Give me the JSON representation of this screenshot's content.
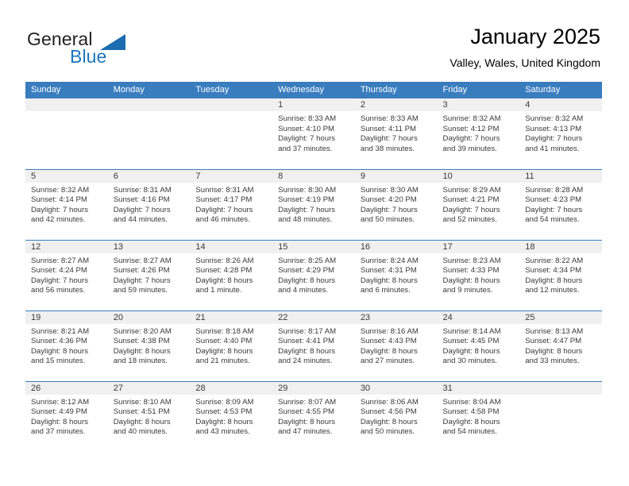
{
  "brand": {
    "name_part1": "General",
    "name_part2": "Blue",
    "triangle_color": "#1b6cb0",
    "text_color": "#231f20",
    "blue_color": "#1b76bc"
  },
  "header": {
    "title": "January 2025",
    "subtitle": "Valley, Wales, United Kingdom"
  },
  "theme": {
    "header_bg": "#3a7dbf",
    "header_text": "#ffffff",
    "daystrip_bg": "#f0f0f0",
    "body_text": "#3a3a3a"
  },
  "weekdays": [
    "Sunday",
    "Monday",
    "Tuesday",
    "Wednesday",
    "Thursday",
    "Friday",
    "Saturday"
  ],
  "labels": {
    "sunrise": "Sunrise:",
    "sunset": "Sunset:",
    "daylight": "Daylight:"
  },
  "weeks": [
    [
      {
        "day": "",
        "empty": true
      },
      {
        "day": "",
        "empty": true
      },
      {
        "day": "",
        "empty": true
      },
      {
        "day": "1",
        "sunrise": "Sunrise: 8:33 AM",
        "sunset": "Sunset: 4:10 PM",
        "daylight1": "Daylight: 7 hours",
        "daylight2": "and 37 minutes."
      },
      {
        "day": "2",
        "sunrise": "Sunrise: 8:33 AM",
        "sunset": "Sunset: 4:11 PM",
        "daylight1": "Daylight: 7 hours",
        "daylight2": "and 38 minutes."
      },
      {
        "day": "3",
        "sunrise": "Sunrise: 8:32 AM",
        "sunset": "Sunset: 4:12 PM",
        "daylight1": "Daylight: 7 hours",
        "daylight2": "and 39 minutes."
      },
      {
        "day": "4",
        "sunrise": "Sunrise: 8:32 AM",
        "sunset": "Sunset: 4:13 PM",
        "daylight1": "Daylight: 7 hours",
        "daylight2": "and 41 minutes."
      }
    ],
    [
      {
        "day": "5",
        "sunrise": "Sunrise: 8:32 AM",
        "sunset": "Sunset: 4:14 PM",
        "daylight1": "Daylight: 7 hours",
        "daylight2": "and 42 minutes."
      },
      {
        "day": "6",
        "sunrise": "Sunrise: 8:31 AM",
        "sunset": "Sunset: 4:16 PM",
        "daylight1": "Daylight: 7 hours",
        "daylight2": "and 44 minutes."
      },
      {
        "day": "7",
        "sunrise": "Sunrise: 8:31 AM",
        "sunset": "Sunset: 4:17 PM",
        "daylight1": "Daylight: 7 hours",
        "daylight2": "and 46 minutes."
      },
      {
        "day": "8",
        "sunrise": "Sunrise: 8:30 AM",
        "sunset": "Sunset: 4:19 PM",
        "daylight1": "Daylight: 7 hours",
        "daylight2": "and 48 minutes."
      },
      {
        "day": "9",
        "sunrise": "Sunrise: 8:30 AM",
        "sunset": "Sunset: 4:20 PM",
        "daylight1": "Daylight: 7 hours",
        "daylight2": "and 50 minutes."
      },
      {
        "day": "10",
        "sunrise": "Sunrise: 8:29 AM",
        "sunset": "Sunset: 4:21 PM",
        "daylight1": "Daylight: 7 hours",
        "daylight2": "and 52 minutes."
      },
      {
        "day": "11",
        "sunrise": "Sunrise: 8:28 AM",
        "sunset": "Sunset: 4:23 PM",
        "daylight1": "Daylight: 7 hours",
        "daylight2": "and 54 minutes."
      }
    ],
    [
      {
        "day": "12",
        "sunrise": "Sunrise: 8:27 AM",
        "sunset": "Sunset: 4:24 PM",
        "daylight1": "Daylight: 7 hours",
        "daylight2": "and 56 minutes."
      },
      {
        "day": "13",
        "sunrise": "Sunrise: 8:27 AM",
        "sunset": "Sunset: 4:26 PM",
        "daylight1": "Daylight: 7 hours",
        "daylight2": "and 59 minutes."
      },
      {
        "day": "14",
        "sunrise": "Sunrise: 8:26 AM",
        "sunset": "Sunset: 4:28 PM",
        "daylight1": "Daylight: 8 hours",
        "daylight2": "and 1 minute."
      },
      {
        "day": "15",
        "sunrise": "Sunrise: 8:25 AM",
        "sunset": "Sunset: 4:29 PM",
        "daylight1": "Daylight: 8 hours",
        "daylight2": "and 4 minutes."
      },
      {
        "day": "16",
        "sunrise": "Sunrise: 8:24 AM",
        "sunset": "Sunset: 4:31 PM",
        "daylight1": "Daylight: 8 hours",
        "daylight2": "and 6 minutes."
      },
      {
        "day": "17",
        "sunrise": "Sunrise: 8:23 AM",
        "sunset": "Sunset: 4:33 PM",
        "daylight1": "Daylight: 8 hours",
        "daylight2": "and 9 minutes."
      },
      {
        "day": "18",
        "sunrise": "Sunrise: 8:22 AM",
        "sunset": "Sunset: 4:34 PM",
        "daylight1": "Daylight: 8 hours",
        "daylight2": "and 12 minutes."
      }
    ],
    [
      {
        "day": "19",
        "sunrise": "Sunrise: 8:21 AM",
        "sunset": "Sunset: 4:36 PM",
        "daylight1": "Daylight: 8 hours",
        "daylight2": "and 15 minutes."
      },
      {
        "day": "20",
        "sunrise": "Sunrise: 8:20 AM",
        "sunset": "Sunset: 4:38 PM",
        "daylight1": "Daylight: 8 hours",
        "daylight2": "and 18 minutes."
      },
      {
        "day": "21",
        "sunrise": "Sunrise: 8:18 AM",
        "sunset": "Sunset: 4:40 PM",
        "daylight1": "Daylight: 8 hours",
        "daylight2": "and 21 minutes."
      },
      {
        "day": "22",
        "sunrise": "Sunrise: 8:17 AM",
        "sunset": "Sunset: 4:41 PM",
        "daylight1": "Daylight: 8 hours",
        "daylight2": "and 24 minutes."
      },
      {
        "day": "23",
        "sunrise": "Sunrise: 8:16 AM",
        "sunset": "Sunset: 4:43 PM",
        "daylight1": "Daylight: 8 hours",
        "daylight2": "and 27 minutes."
      },
      {
        "day": "24",
        "sunrise": "Sunrise: 8:14 AM",
        "sunset": "Sunset: 4:45 PM",
        "daylight1": "Daylight: 8 hours",
        "daylight2": "and 30 minutes."
      },
      {
        "day": "25",
        "sunrise": "Sunrise: 8:13 AM",
        "sunset": "Sunset: 4:47 PM",
        "daylight1": "Daylight: 8 hours",
        "daylight2": "and 33 minutes."
      }
    ],
    [
      {
        "day": "26",
        "sunrise": "Sunrise: 8:12 AM",
        "sunset": "Sunset: 4:49 PM",
        "daylight1": "Daylight: 8 hours",
        "daylight2": "and 37 minutes."
      },
      {
        "day": "27",
        "sunrise": "Sunrise: 8:10 AM",
        "sunset": "Sunset: 4:51 PM",
        "daylight1": "Daylight: 8 hours",
        "daylight2": "and 40 minutes."
      },
      {
        "day": "28",
        "sunrise": "Sunrise: 8:09 AM",
        "sunset": "Sunset: 4:53 PM",
        "daylight1": "Daylight: 8 hours",
        "daylight2": "and 43 minutes."
      },
      {
        "day": "29",
        "sunrise": "Sunrise: 8:07 AM",
        "sunset": "Sunset: 4:55 PM",
        "daylight1": "Daylight: 8 hours",
        "daylight2": "and 47 minutes."
      },
      {
        "day": "30",
        "sunrise": "Sunrise: 8:06 AM",
        "sunset": "Sunset: 4:56 PM",
        "daylight1": "Daylight: 8 hours",
        "daylight2": "and 50 minutes."
      },
      {
        "day": "31",
        "sunrise": "Sunrise: 8:04 AM",
        "sunset": "Sunset: 4:58 PM",
        "daylight1": "Daylight: 8 hours",
        "daylight2": "and 54 minutes."
      },
      {
        "day": "",
        "empty": true
      }
    ]
  ]
}
